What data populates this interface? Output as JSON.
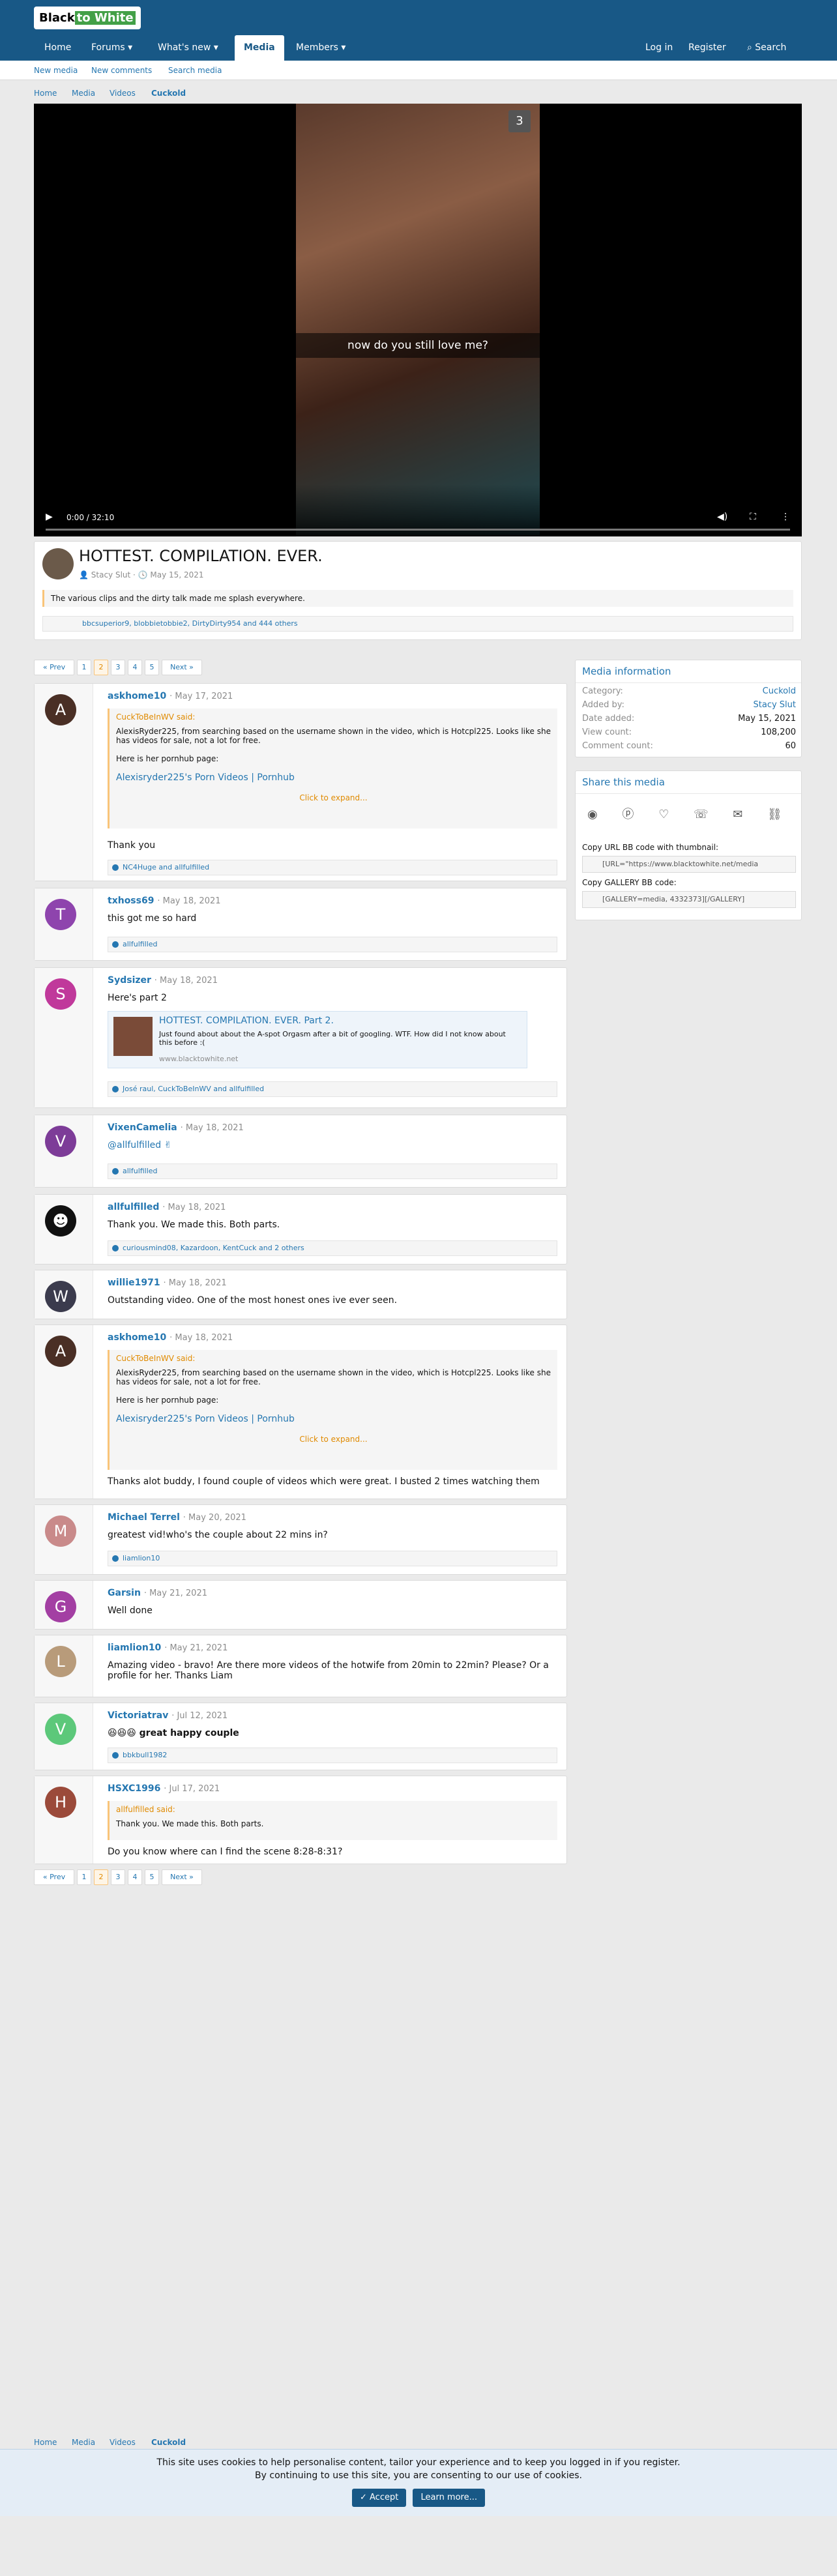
{
  "site": {
    "logo_a": "Black",
    "logo_b": "to White"
  },
  "nav": {
    "home": "Home",
    "forums": "Forums",
    "whats_new": "What's new",
    "media": "Media",
    "members": "Members",
    "login": "Log in",
    "register": "Register",
    "search": "Search"
  },
  "subnav": {
    "new_media": "New media",
    "new_comments": "New comments",
    "search_media": "Search media"
  },
  "breadcrumb": [
    "Home",
    "Media",
    "Videos",
    "Cuckold"
  ],
  "video": {
    "counter": "3",
    "caption": "now do you still love me?",
    "time": "0:00 / 32:10"
  },
  "item": {
    "title": "HOTTEST. COMPILATION. EVER.",
    "author": "Stacy Slut",
    "date": "May 15, 2021",
    "description": "The various clips and the dirty talk made me splash everywhere.",
    "reactions": "bbcsuperior9, blobbietobbie2, DirtyDirty954 and 444 others"
  },
  "pagination": {
    "prev": "« Prev",
    "pages": [
      "1",
      "2",
      "3",
      "4",
      "5"
    ],
    "current": "2",
    "next": "Next »"
  },
  "media_info": {
    "heading": "Media information",
    "rows": [
      {
        "k": "Category:",
        "v": "Cuckold"
      },
      {
        "k": "Added by:",
        "v": "Stacy Slut"
      },
      {
        "k": "Date added:",
        "v": "May 15, 2021"
      },
      {
        "k": "View count:",
        "v": "108,200"
      },
      {
        "k": "Comment count:",
        "v": "60"
      }
    ]
  },
  "share": {
    "heading": "Share this media",
    "bb_label": "Copy URL BB code with thumbnail:",
    "bb_value": "[URL=\"https://www.blacktowhite.net/media",
    "gallery_label": "Copy GALLERY BB code:",
    "gallery_value": "[GALLERY=media, 4332373][/GALLERY]"
  },
  "quote_common": {
    "said": "CuckToBeInWV said:",
    "line1": "AlexisRyder225, from searching based on the username shown in the video, which is Hotcpl225. Looks like she has videos for sale, not a lot for free.",
    "line2": "Here is her pornhub page:",
    "link": "Alexisryder225's Porn Videos | Pornhub",
    "expand": "Click to expand..."
  },
  "posts": [
    {
      "user": "askhome10",
      "date": "· May 17, 2021",
      "text": "Thank you",
      "reactions": "NC4Huge and allfulfilled",
      "color": "#5a3a2c",
      "initial": "A"
    },
    {
      "user": "txhoss69",
      "date": "· May 18, 2021",
      "text": "this got me so hard",
      "reactions": "allfulfilled",
      "color": "#8e44ad",
      "initial": "T"
    },
    {
      "user": "Sydsizer",
      "date": "· May 18, 2021",
      "text": "Here's part 2",
      "reactions": "José raul, CuckToBeInWV and allfulfilled",
      "color": "#c0399b",
      "initial": "S",
      "embed_title": "HOTTEST. COMPILATION. EVER. Part 2.",
      "embed_desc": "Just found about about the A-spot Orgasm after a bit of googling. WTF. How did I not know about this before :(",
      "embed_site": "www.blacktowhite.net"
    },
    {
      "user": "VixenCamelia",
      "date": "· May 18, 2021",
      "text": "@allfulfilled ✌",
      "reactions": "allfulfilled",
      "color": "#7d3c98",
      "initial": "V"
    },
    {
      "user": "allfulfilled",
      "date": "· May 18, 2021",
      "text": "Thank you. We made this. Both parts.",
      "reactions": "curiousmind08, Kazardoon, KentCuck and 2 others",
      "color": "#111",
      "initial": "☻"
    },
    {
      "user": "willie1971",
      "date": "· May 18, 2021",
      "text": "Outstanding video. One of the most honest ones ive ever seen.",
      "color": "#3b3b4d",
      "initial": "W"
    },
    {
      "user": "askhome10",
      "date": "· May 18, 2021",
      "text": "Thanks alot buddy, I found couple of videos which were great. I busted 2 times watching them",
      "color": "#5a3a2c",
      "initial": "A"
    },
    {
      "user": "Michael Terrel",
      "date": "· May 20, 2021",
      "text": "greatest vid!who's the couple about 22 mins in?",
      "reactions": "liamlion10",
      "color": "#c98a8a",
      "initial": "M"
    },
    {
      "user": "Garsin",
      "date": "· May 21, 2021",
      "text": "Well done",
      "color": "#a33fa3",
      "initial": "G"
    },
    {
      "user": "liamlion10",
      "date": "· May 21, 2021",
      "text": "Amazing video - bravo! Are there more videos of the hotwife from 20min to 22min? Please? Or a profile for her. Thanks Liam",
      "color": "#b89b7a",
      "initial": "L"
    },
    {
      "user": "Victoriatrav",
      "date": "· Jul 12, 2021",
      "text": "😆😆😆 great happy couple",
      "reactions": "bbkbull1982",
      "color": "#5cc87a",
      "initial": "V"
    },
    {
      "user": "HSXC1996",
      "date": "· Jul 17, 2021",
      "text": "Do you know where can I find the scene 8:28-8:31?",
      "quote_said": "allfulfilled said:",
      "quote_text": "Thank you. We made this. Both parts.",
      "color": "#9b4a3a",
      "initial": "H"
    }
  ],
  "cookie": {
    "line1": "This site uses cookies to help personalise content, tailor your experience and to keep you logged in if you register.",
    "line2": "By continuing to use this site, you are consenting to our use of cookies.",
    "accept": "✓ Accept",
    "learn": "Learn more..."
  }
}
